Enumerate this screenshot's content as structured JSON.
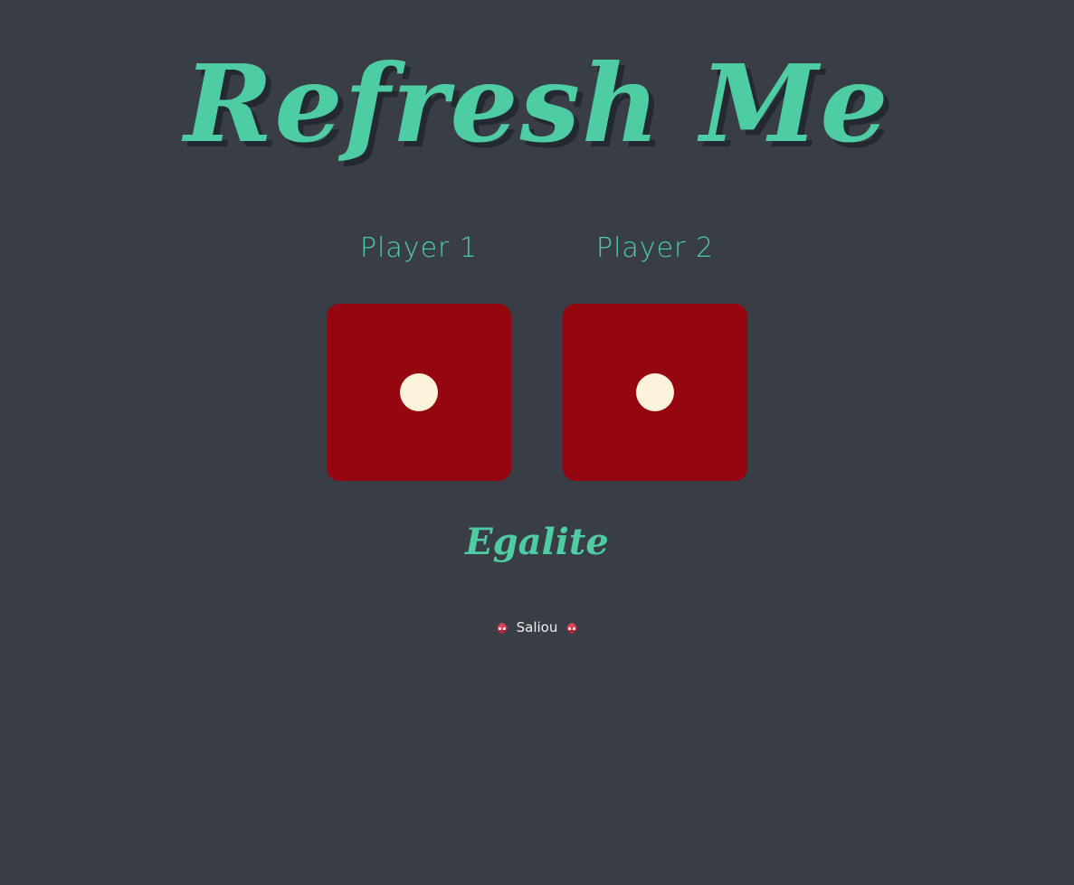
{
  "title": "Refresh Me",
  "players": [
    {
      "label": "Player 1",
      "die_value": 1
    },
    {
      "label": "Player 2",
      "die_value": 1
    }
  ],
  "result": "Egalite",
  "footer": {
    "author": "Saliou",
    "left_icon": "dice-icon",
    "right_icon": "dice-icon"
  },
  "colors": {
    "background": "#393e46",
    "accent": "#4ecca3",
    "die": "#950610",
    "pip": "#fdf3db",
    "title_shadow": "#232931"
  }
}
